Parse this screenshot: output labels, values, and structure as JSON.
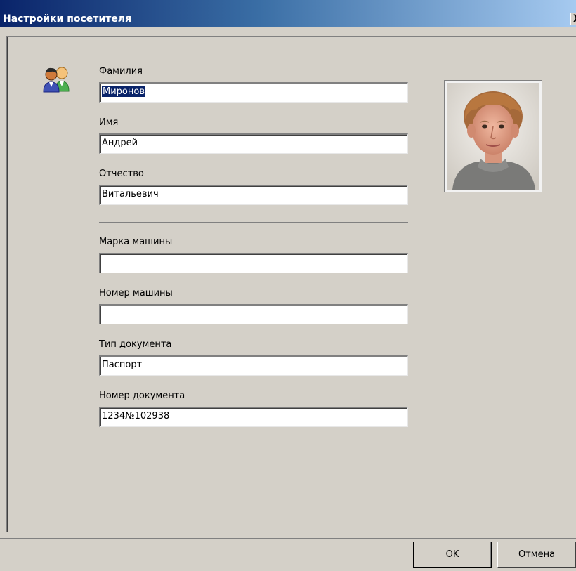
{
  "window": {
    "title": "Настройки посетителя",
    "close_glyph": "X"
  },
  "icons": {
    "visitor": "users-icon",
    "photo": "visitor-photo"
  },
  "form": {
    "last_name": {
      "label": "Фамилия",
      "value": "Миронов"
    },
    "first_name": {
      "label": "Имя",
      "value": "Андрей"
    },
    "patronymic": {
      "label": "Отчество",
      "value": "Витальевич"
    },
    "car_brand": {
      "label": "Марка машины",
      "value": ""
    },
    "car_number": {
      "label": "Номер машины",
      "value": ""
    },
    "doc_type": {
      "label": "Тип документа",
      "value": "Паспорт"
    },
    "doc_number": {
      "label": "Номер документа",
      "value": "1234№102938"
    }
  },
  "buttons": {
    "ok": "OK",
    "cancel": "Отмена"
  },
  "colors": {
    "title_bar_start": "#0a246a",
    "title_bar_end": "#a6caf0",
    "dialog_bg": "#d4d0c8",
    "selection": "#0a246a"
  }
}
